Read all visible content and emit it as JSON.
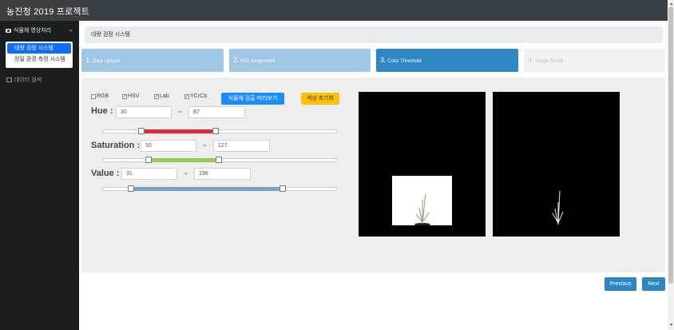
{
  "app": {
    "title": "농진청 2019 프로젝트"
  },
  "sidebar": {
    "group_label": "식물체 영상처리",
    "menu_items": [
      {
        "label": "대량 검정 시스템",
        "active": true
      },
      {
        "label": "정밀 환경 측정 시스템",
        "active": false
      }
    ],
    "search_label": "데이터 검색"
  },
  "breadcrumb": {
    "text": "대량 검정 시스템"
  },
  "steps": [
    {
      "num": "1.",
      "label": "Data Upload",
      "state": "done"
    },
    {
      "num": "2.",
      "label": "ROI assignment",
      "state": "done"
    },
    {
      "num": "3.",
      "label": "Color Threshold",
      "state": "active"
    },
    {
      "num": "4.",
      "label": "Image Result",
      "state": "pending"
    }
  ],
  "color_spaces": [
    {
      "label": "RGB",
      "checked": false
    },
    {
      "label": "HSV",
      "checked": true
    },
    {
      "label": "Lab",
      "checked": true
    },
    {
      "label": "YCrCb",
      "checked": true
    }
  ],
  "buttons": {
    "preview": "식물체 검출 미리보기",
    "reset": "색상 초기화",
    "previous": "Previous",
    "next": "Next"
  },
  "sliders": {
    "tilde": "~",
    "hue": {
      "label": "Hue :",
      "min": "30",
      "max": "87",
      "range_min_frac": 0.167,
      "range_max_frac": 0.483,
      "color": "#e02b35"
    },
    "saturation": {
      "label": "Saturation :",
      "min": "50",
      "max": "127",
      "range_min_frac": 0.196,
      "range_max_frac": 0.498,
      "color": "#8fd14f"
    },
    "value": {
      "label": "Value :",
      "min": "31",
      "max": "196",
      "range_min_frac": 0.122,
      "range_max_frac": 0.769,
      "color": "#7ba4c9"
    }
  },
  "colors": {
    "accent": "#2f86c4",
    "step_done": "#9ec5e3",
    "sidebar_bg": "#1b1e21",
    "topbar_bg": "#3a3f44"
  }
}
